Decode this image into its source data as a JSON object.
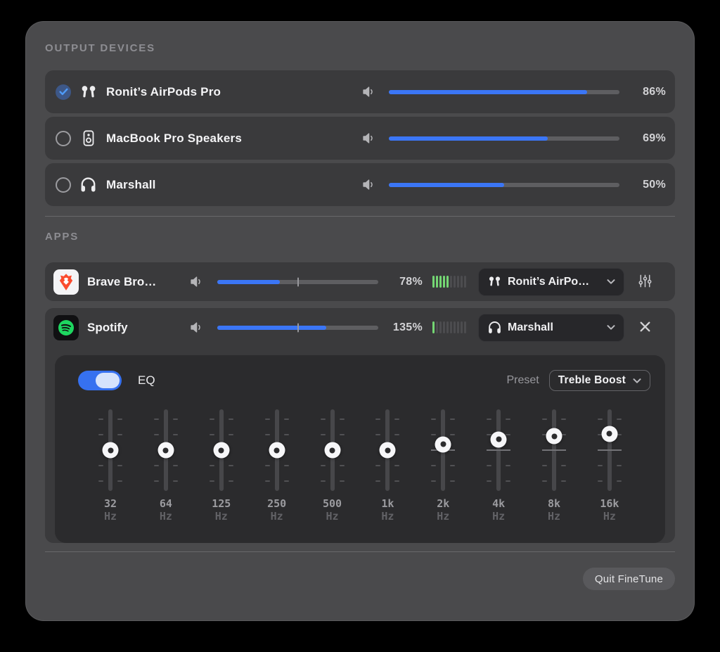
{
  "output_devices": {
    "title": "OUTPUT DEVICES",
    "devices": [
      {
        "name": "Ronit’s AirPods Pro",
        "icon": "airpods-icon",
        "selected": true,
        "volume_pct": 86,
        "volume_label": "86%"
      },
      {
        "name": "MacBook Pro Speakers",
        "icon": "speaker-box-icon",
        "selected": false,
        "volume_pct": 69,
        "volume_label": "69%"
      },
      {
        "name": "Marshall",
        "icon": "headphones-icon",
        "selected": false,
        "volume_pct": 50,
        "volume_label": "50%"
      }
    ]
  },
  "apps": {
    "title": "APPS",
    "rows": [
      {
        "app_name": "Brave Bro…",
        "icon": "brave-icon",
        "volume_pct": 78,
        "volume_max_pct": 200,
        "volume_label": "78%",
        "meter": {
          "total": 10,
          "lit": 5
        },
        "output_device": {
          "label": "Ronit’s AirPo…",
          "icon": "airpods-icon"
        },
        "action": {
          "icon": "eq-sliders-icon",
          "type": "open-eq"
        }
      },
      {
        "app_name": "Spotify",
        "icon": "spotify-icon",
        "volume_pct": 135,
        "volume_max_pct": 200,
        "volume_label": "135%",
        "meter": {
          "total": 10,
          "lit": 1
        },
        "output_device": {
          "label": "Marshall",
          "icon": "headphones-icon"
        },
        "action": {
          "icon": "close-icon",
          "type": "close-eq"
        },
        "eq_expanded": true
      }
    ]
  },
  "eq": {
    "enabled": true,
    "label": "EQ",
    "preset_label": "Preset",
    "preset_value": "Treble Boost",
    "bands": [
      {
        "freq": "32",
        "unit": "Hz",
        "knob_top_pct": 50
      },
      {
        "freq": "64",
        "unit": "Hz",
        "knob_top_pct": 50
      },
      {
        "freq": "125",
        "unit": "Hz",
        "knob_top_pct": 50
      },
      {
        "freq": "250",
        "unit": "Hz",
        "knob_top_pct": 50
      },
      {
        "freq": "500",
        "unit": "Hz",
        "knob_top_pct": 50
      },
      {
        "freq": "1k",
        "unit": "Hz",
        "knob_top_pct": 50
      },
      {
        "freq": "2k",
        "unit": "Hz",
        "knob_top_pct": 43
      },
      {
        "freq": "4k",
        "unit": "Hz",
        "knob_top_pct": 37
      },
      {
        "freq": "8k",
        "unit": "Hz",
        "knob_top_pct": 33
      },
      {
        "freq": "16k",
        "unit": "Hz",
        "knob_top_pct": 30
      }
    ]
  },
  "footer": {
    "quit_label": "Quit FineTune"
  },
  "colors": {
    "accent_blue": "#3b76f6",
    "meter_green": "#74d673",
    "brave_orange": "#fb4b2e",
    "spotify_green": "#1ed760",
    "window_bg": "#4a4a4c",
    "row_bg": "#3a3a3c",
    "eq_panel_bg": "#2b2b2d"
  }
}
